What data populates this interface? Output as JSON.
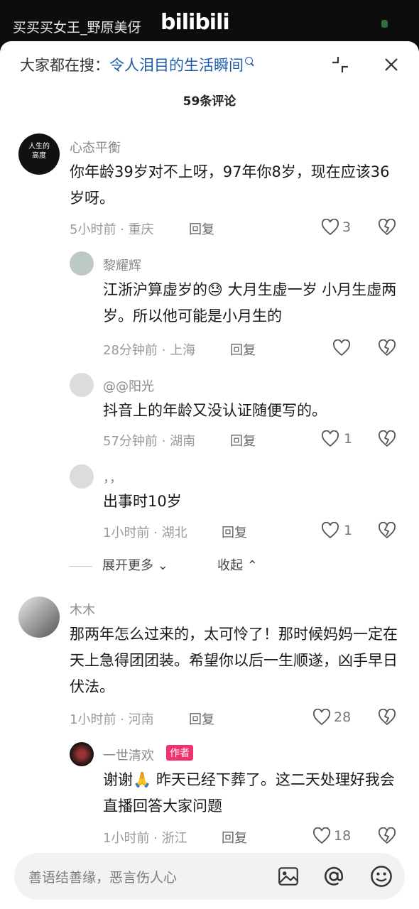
{
  "top": {
    "title": "买买买女王_野原美伢",
    "logo": "bilibili"
  },
  "search": {
    "prefix": "大家都在搜：",
    "term": "令人泪目的生活瞬间"
  },
  "comments_count": "59条评论",
  "comments": [
    {
      "name": "心态平衡",
      "text": "你年龄39岁对不上呀，97年你8岁，现在应该36岁呀。",
      "time": "5小时前",
      "location": "重庆",
      "reply": "回复",
      "likes": "3"
    },
    {
      "name": "黎耀辉",
      "text": "江浙沪算虚岁的😓 大月生虚一岁 小月生虚两岁。所以他可能是小月生的",
      "time": "28分钟前",
      "location": "上海",
      "reply": "回复",
      "likes": ""
    },
    {
      "name": "@@阳光",
      "text": "抖音上的年龄又没认证随便写的。",
      "time": "57分钟前",
      "location": "湖南",
      "reply": "回复",
      "likes": "1"
    },
    {
      "name": "，，",
      "text": "出事时10岁",
      "time": "1小时前",
      "location": "湖北",
      "reply": "回复",
      "likes": "1"
    },
    {
      "name": "木木",
      "text": "那两年怎么过来的，太可怜了！那时候妈妈一定在天上急得团团装。希望你以后一生顺遂，凶手早日伏法。",
      "time": "1小时前",
      "location": "河南",
      "reply": "回复",
      "likes": "28"
    },
    {
      "name": "一世清欢",
      "badge": "作者",
      "text": "谢谢🙏 昨天已经下葬了。这二天处理好我会直播回答大家问题",
      "time": "1小时前",
      "location": "浙江",
      "reply": "回复",
      "likes": "18"
    }
  ],
  "expand": {
    "more": "展开更多",
    "collapse": "收起"
  },
  "input": {
    "placeholder": "善语结善缘，恶言伤人心"
  },
  "avatar_texts": {
    "first": "人生的高度"
  }
}
